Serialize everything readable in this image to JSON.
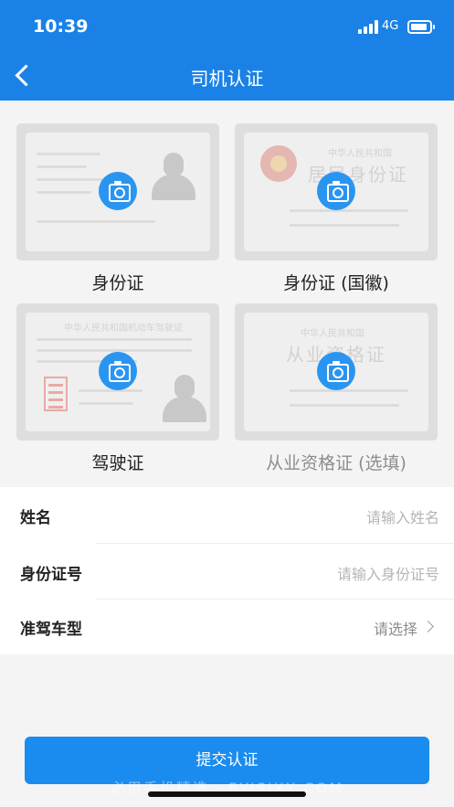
{
  "status_bar": {
    "time": "10:39",
    "network": "4G"
  },
  "header": {
    "title": "司机认证",
    "back_icon": "chevron-left-icon"
  },
  "cards": [
    {
      "label": "身份证",
      "muted": false,
      "icon": "camera-icon"
    },
    {
      "label": "身份证 (国徽)",
      "muted": false,
      "icon": "camera-icon",
      "sample_title": "中华人民共和国",
      "sample_big": "居民身份证"
    },
    {
      "label": "驾驶证",
      "muted": false,
      "icon": "camera-icon",
      "sample_title": "中华人民共和国机动车驾驶证"
    },
    {
      "label": "从业资格证 (选填)",
      "muted": true,
      "icon": "camera-icon",
      "sample_title": "中华人民共和国",
      "sample_big": "从业资格证"
    }
  ],
  "form": {
    "name": {
      "label": "姓名",
      "placeholder": "请输入姓名"
    },
    "id_number": {
      "label": "身份证号",
      "placeholder": "请输入身份证号"
    },
    "license_type": {
      "label": "准驾车型",
      "value": "请选择"
    }
  },
  "submit_label": "提交认证",
  "watermark": "必用手机精选 · BYJSJXX.COM",
  "colors": {
    "primary": "#1a82e6",
    "button": "#1a8cf0",
    "camera": "#2a95f0"
  }
}
